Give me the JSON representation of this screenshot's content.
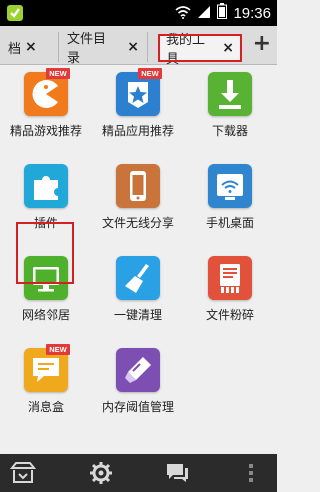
{
  "status_bar": {
    "time": "19:36",
    "icons": [
      "app-notification-icon",
      "wifi-icon",
      "signal-icon",
      "battery-icon"
    ]
  },
  "tabs": [
    {
      "label": "档",
      "close": "×"
    },
    {
      "label": "文件目录",
      "close": "×"
    },
    {
      "label": "我的工具",
      "close": "×",
      "active": true
    }
  ],
  "add_tab": "+",
  "tools": [
    {
      "label": "精品游戏推荐",
      "badge": "NEW",
      "icon": "game-pacman-icon",
      "color": "#f07a1c"
    },
    {
      "label": "精品应用推荐",
      "badge": "NEW",
      "icon": "app-star-icon",
      "color": "#2d7fd0"
    },
    {
      "label": "下载器",
      "icon": "download-icon",
      "color": "#58b233"
    },
    {
      "label": "插件",
      "icon": "puzzle-icon",
      "color": "#22a8d8"
    },
    {
      "label": "文件无线分享",
      "icon": "phone-share-icon",
      "color": "#c8743a"
    },
    {
      "label": "手机桌面",
      "icon": "wifi-desktop-icon",
      "color": "#2f86cf"
    },
    {
      "label": "网络邻居",
      "icon": "monitor-icon",
      "color": "#4fb02c"
    },
    {
      "label": "一键清理",
      "icon": "broom-icon",
      "color": "#2aa1e4"
    },
    {
      "label": "文件粉碎",
      "icon": "shred-icon",
      "color": "#e2523a"
    },
    {
      "label": "消息盒",
      "badge": "NEW",
      "icon": "message-box-icon",
      "color": "#f0a81c"
    },
    {
      "label": "内存阈值管理",
      "icon": "memory-icon",
      "color": "#7d4fb3"
    }
  ],
  "bottom_bar": [
    "store-icon",
    "settings-icon",
    "chat-icon",
    "more-icon"
  ]
}
